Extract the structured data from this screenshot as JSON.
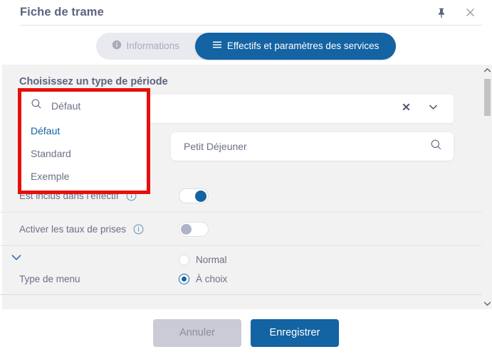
{
  "window": {
    "title": "Fiche de trame",
    "pin_icon": "pin-icon",
    "close_icon": "close-icon"
  },
  "tabs": [
    {
      "label": "Informations",
      "icon": "info-circle-icon",
      "active": false
    },
    {
      "label": "Effectifs et paramètres des services",
      "icon": "list-lines-icon",
      "active": true
    }
  ],
  "main": {
    "section_title": "Choisissez un type de période",
    "period_select": {
      "value": "",
      "clear_icon": "close-x-icon",
      "expand_icon": "chevron-down-icon"
    },
    "service_search": {
      "value": "Petit Déjeuner",
      "search_icon": "search-icon"
    },
    "collapse_icon": "chevron-down-icon"
  },
  "dropdown": {
    "search_value": "Défaut",
    "search_icon": "search-icon",
    "options": [
      {
        "label": "Défaut",
        "selected": true
      },
      {
        "label": "Standard",
        "selected": false
      },
      {
        "label": "Exemple",
        "selected": false
      }
    ],
    "highlight_color": "#e5100c"
  },
  "settings": {
    "rows": [
      {
        "label": "Est inclus dans l'effectif",
        "info_icon": "info-icon",
        "toggle": "on"
      },
      {
        "label": "Activer les taux de prises",
        "info_icon": "info-icon",
        "toggle": "off"
      }
    ],
    "menu_type": {
      "label": "Type de menu",
      "options": [
        {
          "label": "Normal",
          "selected": false
        },
        {
          "label": "À choix",
          "selected": true
        }
      ]
    }
  },
  "scrollbar": {
    "up_icon": "chevron-up-icon",
    "down_icon": "chevron-down-icon"
  },
  "footer": {
    "cancel_label": "Annuler",
    "save_label": "Enregistrer"
  },
  "colors": {
    "accent": "#1463a3",
    "text": "#6b7087",
    "title": "#5b6480",
    "panel_bg": "#f2f2f2",
    "highlight": "#e5100c"
  }
}
